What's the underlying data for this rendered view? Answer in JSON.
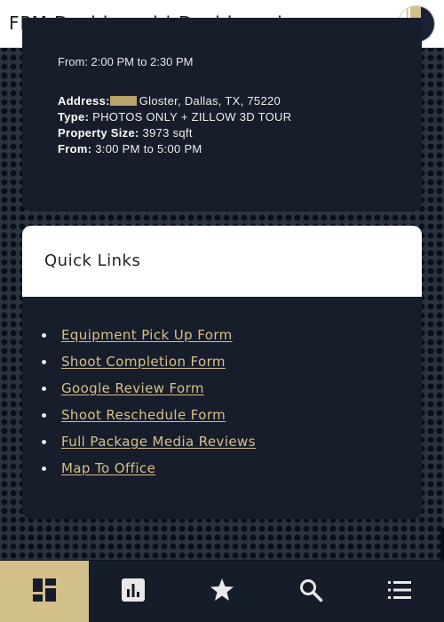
{
  "app": {
    "title": "FPM Dashboard | Dashboard"
  },
  "appointment_partial": {
    "text": "From: 2:00 PM to 2:30 PM"
  },
  "appointment": {
    "address_label": "Address:",
    "address_value": "Gloster, Dallas, TX, 75220",
    "type_label": "Type:",
    "type_value": "PHOTOS ONLY + ZILLOW 3D TOUR",
    "size_label": "Property Size:",
    "size_value": "3973 sqft",
    "time_label": "From:",
    "time_value": "3:00 PM to 5:00 PM"
  },
  "quick_links": {
    "title": "Quick Links",
    "items": [
      {
        "label": "Equipment Pick Up Form"
      },
      {
        "label": "Shoot Completion Form"
      },
      {
        "label": "Google Review Form"
      },
      {
        "label": "Shoot Reschedule Form"
      },
      {
        "label": "Full Package Media Reviews"
      },
      {
        "label": "Map To Office"
      }
    ]
  },
  "bottom_nav": {
    "items": [
      {
        "icon": "dashboard-icon",
        "active": true
      },
      {
        "icon": "bar-chart-icon",
        "active": false
      },
      {
        "icon": "star-icon",
        "active": false
      },
      {
        "icon": "search-icon",
        "active": false
      },
      {
        "icon": "list-icon",
        "active": false
      }
    ]
  },
  "colors": {
    "accent_gold": "#d2c08a",
    "link_gold": "#d5c08a",
    "card_navy": "#171d2b",
    "nav_navy": "#161c29"
  }
}
